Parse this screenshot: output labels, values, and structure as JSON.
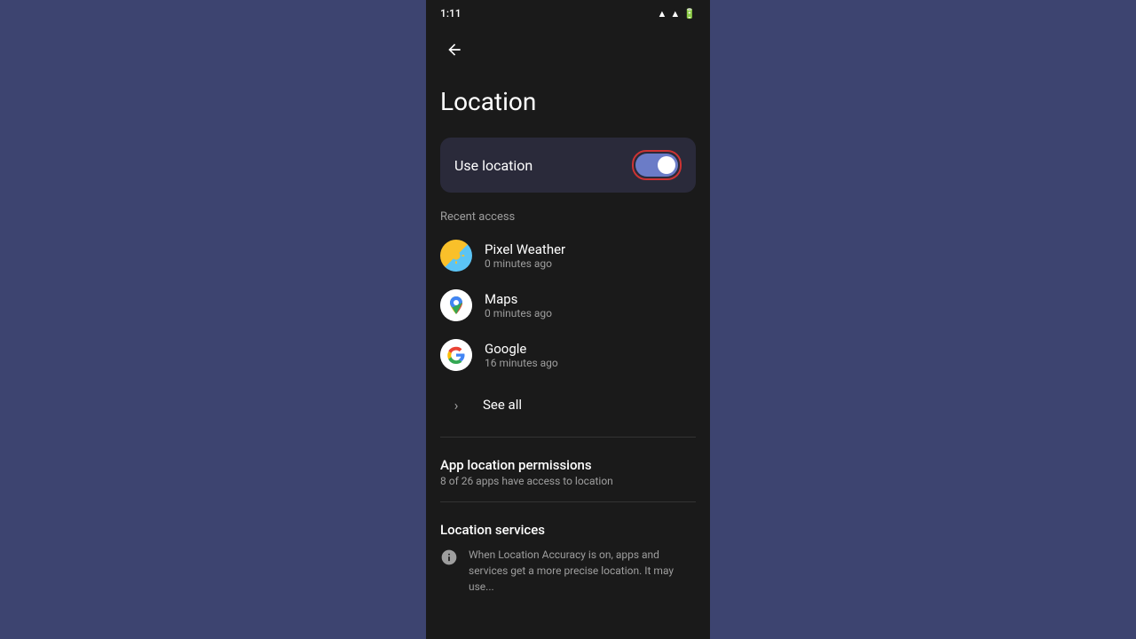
{
  "statusBar": {
    "time": "1:11",
    "icons": [
      "battery-icon",
      "sim-icon",
      "screen-icon",
      "play-icon",
      "wifi-icon",
      "signal-icon",
      "battery-full-icon"
    ]
  },
  "nav": {
    "backLabel": "←"
  },
  "page": {
    "title": "Location",
    "useLocation": {
      "label": "Use location",
      "enabled": true
    },
    "recentAccess": {
      "sectionLabel": "Recent access",
      "apps": [
        {
          "name": "Pixel Weather",
          "time": "0 minutes ago",
          "icon": "weather"
        },
        {
          "name": "Maps",
          "time": "0 minutes ago",
          "icon": "maps"
        },
        {
          "name": "Google",
          "time": "16 minutes ago",
          "icon": "google"
        }
      ],
      "seeAll": "See all"
    },
    "appLocationPermissions": {
      "title": "App location permissions",
      "subtitle": "8 of 26 apps have access to location"
    },
    "locationServices": {
      "title": "Location services",
      "infoText": "When Location Accuracy is on, apps and services get a more precise location. It may use..."
    }
  }
}
